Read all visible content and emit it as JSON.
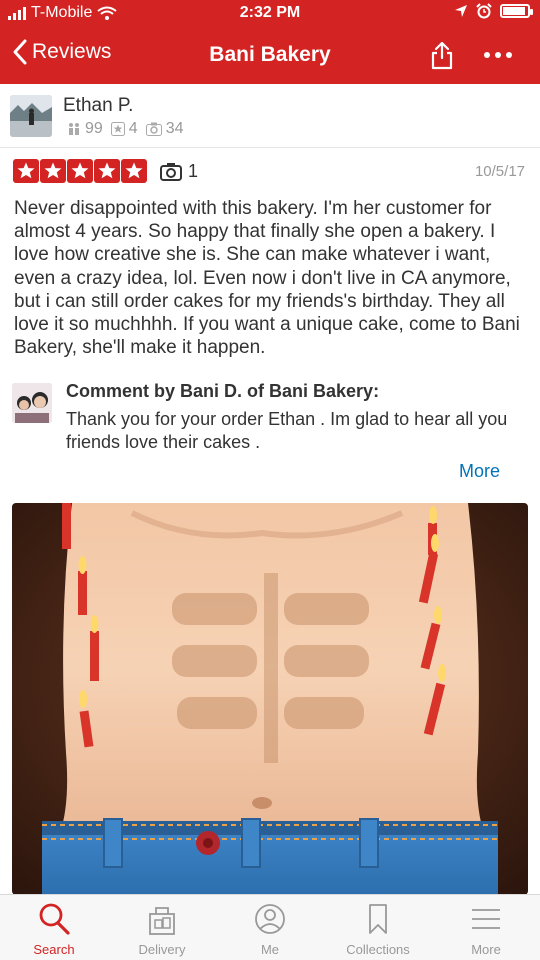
{
  "status_bar": {
    "carrier": "T-Mobile",
    "time": "2:32 PM",
    "battery_level": 0.9
  },
  "nav": {
    "back_label": "Reviews",
    "title": "Bani Bakery"
  },
  "reviewer": {
    "name": "Ethan P.",
    "friends": "99",
    "reviews": "4",
    "photos": "34"
  },
  "review": {
    "rating": 5,
    "photo_count": "1",
    "date": "10/5/17",
    "text": "Never disappointed with this bakery. I'm her customer for almost 4 years. So happy that finally she open a bakery. I love how creative she is. She can make whatever i want, even a crazy idea, lol. Even now i don't live in CA anymore, but i can still order cakes for my friends's birthday. They all love it so muchhhh. If you want a unique cake, come to Bani Bakery, she'll make it happen."
  },
  "comment": {
    "heading": "Comment by Bani D. of Bani Bakery:",
    "text": "Thank you for your order Ethan . Im glad to hear all you friends love their cakes .",
    "more_label": "More"
  },
  "tabs": [
    {
      "label": "Search",
      "icon": "search-icon",
      "active": true
    },
    {
      "label": "Delivery",
      "icon": "delivery-bag-icon",
      "active": false
    },
    {
      "label": "Me",
      "icon": "profile-icon",
      "active": false
    },
    {
      "label": "Collections",
      "icon": "bookmark-icon",
      "active": false
    },
    {
      "label": "More",
      "icon": "menu-icon",
      "active": false
    }
  ],
  "colors": {
    "brand_red": "#d32323",
    "link_blue": "#0073bb",
    "muted_gray": "#999999",
    "tab_bar_bg": "#f7f7f7"
  }
}
